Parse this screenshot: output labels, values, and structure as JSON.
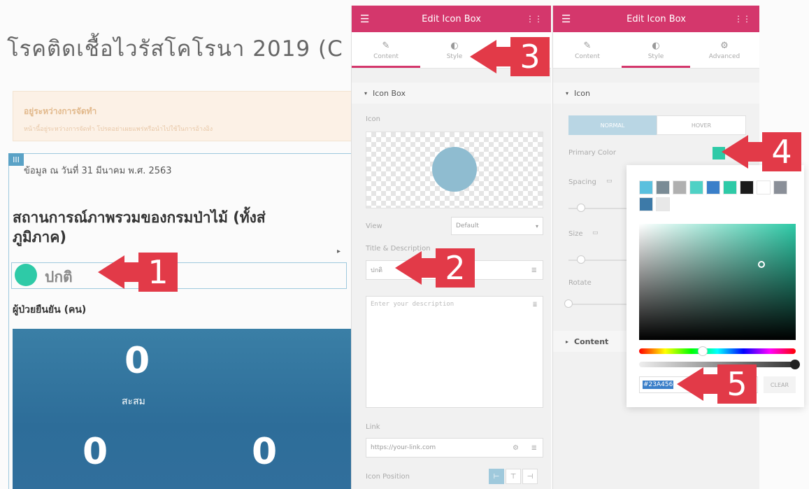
{
  "page": {
    "title": "โรคติดเชื้อไวรัสโคโรนา 2019 (C",
    "notice_title": "อยู่ระหว่างการจัดทำ",
    "notice_body": "หน้านี้อยู่ระหว่างการจัดทำ โปรดอย่าเผยแพร่หรือนำไปใช้ในการอ้างอิง",
    "handle": "III",
    "data_date": "ข้อมูล ณ วันที่ 31 มีนาคม พ.ศ. 2563",
    "section_title_line1": "สถานการณ์ภาพรวมของกรมป่าไม้ (ทั้งส่",
    "section_title_line2": "ภูมิภาค)",
    "status_label": "ปกติ",
    "patients_label": "ผู้ป่วยยืนยัน (คน)",
    "stat_total": "0",
    "stat_total_label": "สะสม",
    "stat_left": "0",
    "stat_right": "0"
  },
  "panel1": {
    "title": "Edit Icon Box",
    "tabs": [
      "Content",
      "Style"
    ],
    "section": "Icon Box",
    "icon_label": "Icon",
    "view_label": "View",
    "view_value": "Default",
    "title_desc_label": "Title & Description",
    "title_value": "ปกติ",
    "desc_placeholder": "Enter your description",
    "link_label": "Link",
    "link_placeholder": "https://your-link.com",
    "icon_position_label": "Icon Position"
  },
  "panel2": {
    "title": "Edit Icon Box",
    "tabs": [
      "Content",
      "Style",
      "Advanced"
    ],
    "section": "Icon",
    "state_tabs": [
      "NORMAL",
      "HOVER"
    ],
    "primary_color_label": "Primary Color",
    "spacing_label": "Spacing",
    "size_label": "Size",
    "rotate_label": "Rotate",
    "content_section": "Content"
  },
  "color_picker": {
    "hex_value": "#23A456",
    "clear_label": "CLEAR",
    "swatches": [
      "#5bc0de",
      "#7a8b95",
      "#b0b0b0",
      "#4fd1c5",
      "#3a7fc9",
      "#2ecaa7",
      "#1a1a1a",
      "#ffffff",
      "#8a8f98",
      "#3d7aa8",
      "#e8e8e8"
    ]
  },
  "callouts": [
    "1",
    "2",
    "3",
    "4",
    "5"
  ],
  "colors": {
    "accent": "#d4376c",
    "callout": "#e23a48",
    "status": "#2ecaa7"
  }
}
